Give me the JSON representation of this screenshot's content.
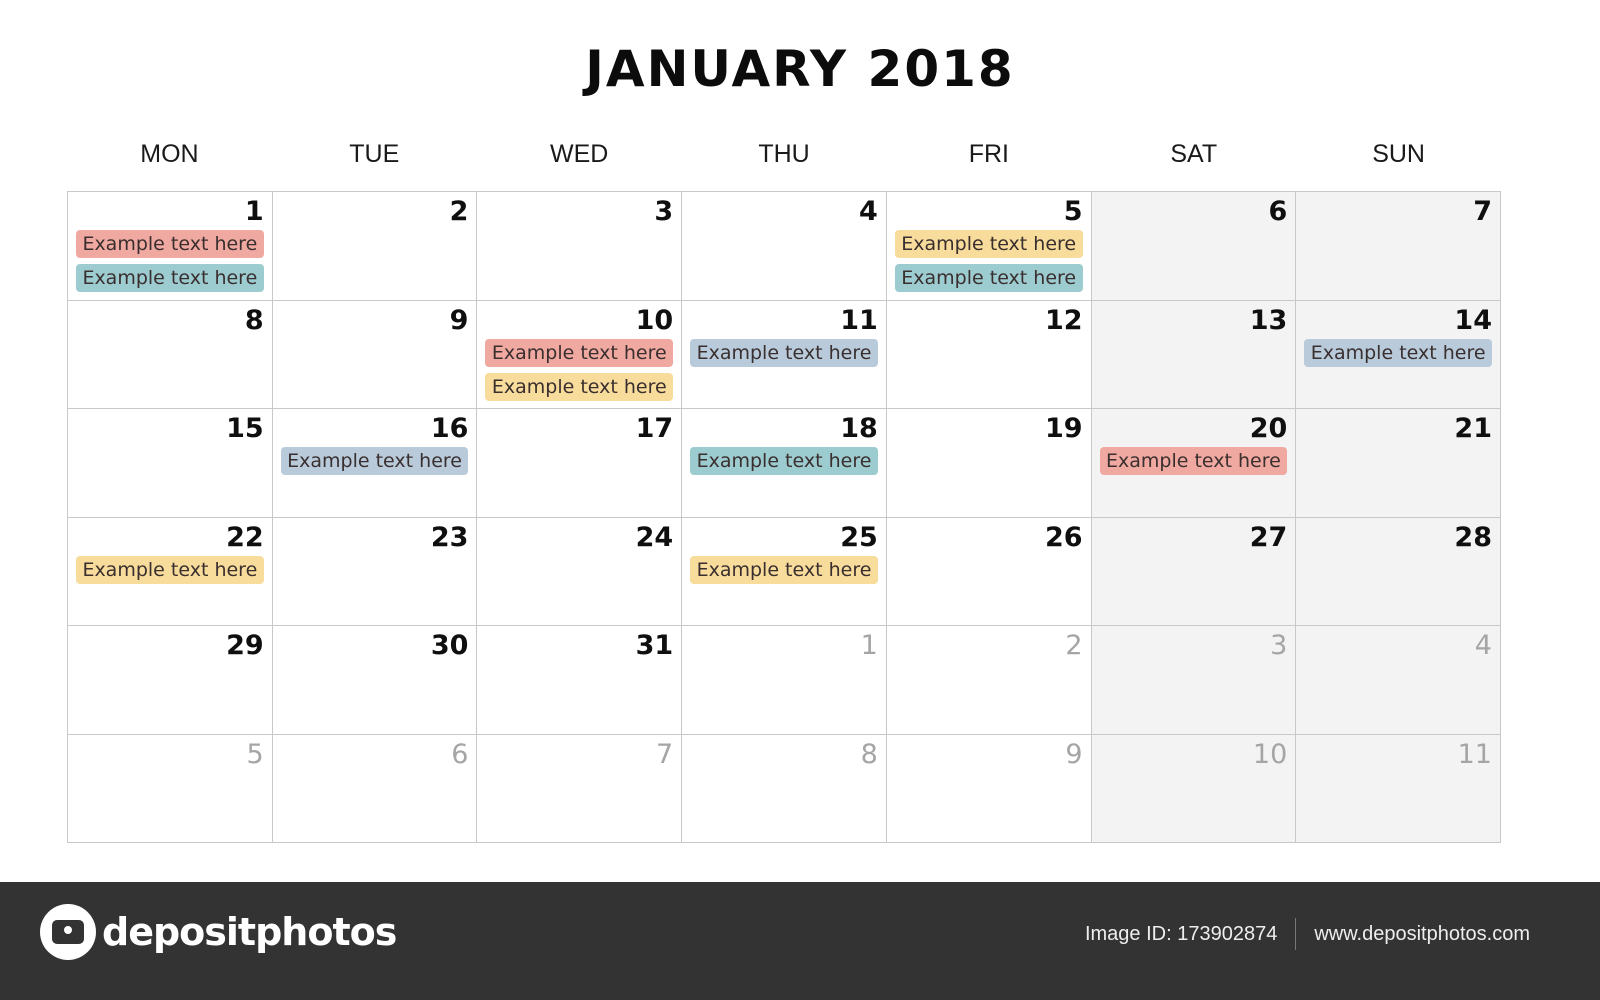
{
  "calendar": {
    "title": "JANUARY 2018",
    "weekdays": [
      "MON",
      "TUE",
      "WED",
      "THU",
      "FRI",
      "SAT",
      "SUN"
    ],
    "event_colors": {
      "red": "#f0a9a0",
      "teal": "#9ccbd0",
      "yellow": "#f8dc9c",
      "blue": "#b9cbdb"
    },
    "weeks": [
      [
        {
          "day": "1",
          "current": true,
          "events": [
            {
              "text": "Example text here",
              "color": "red"
            },
            {
              "text": "Example text here",
              "color": "teal"
            }
          ]
        },
        {
          "day": "2",
          "current": true,
          "events": []
        },
        {
          "day": "3",
          "current": true,
          "events": []
        },
        {
          "day": "4",
          "current": true,
          "events": []
        },
        {
          "day": "5",
          "current": true,
          "events": [
            {
              "text": "Example text here",
              "color": "yellow"
            },
            {
              "text": "Example text here",
              "color": "teal"
            }
          ]
        },
        {
          "day": "6",
          "current": true,
          "events": []
        },
        {
          "day": "7",
          "current": true,
          "events": []
        }
      ],
      [
        {
          "day": "8",
          "current": true,
          "events": []
        },
        {
          "day": "9",
          "current": true,
          "events": []
        },
        {
          "day": "10",
          "current": true,
          "events": [
            {
              "text": "Example text here",
              "color": "red"
            },
            {
              "text": "Example text here",
              "color": "yellow"
            }
          ]
        },
        {
          "day": "11",
          "current": true,
          "events": [
            {
              "text": "Example text here",
              "color": "blue"
            }
          ]
        },
        {
          "day": "12",
          "current": true,
          "events": []
        },
        {
          "day": "13",
          "current": true,
          "events": []
        },
        {
          "day": "14",
          "current": true,
          "events": [
            {
              "text": "Example text here",
              "color": "blue"
            }
          ]
        }
      ],
      [
        {
          "day": "15",
          "current": true,
          "events": []
        },
        {
          "day": "16",
          "current": true,
          "events": [
            {
              "text": "Example text here",
              "color": "blue"
            }
          ]
        },
        {
          "day": "17",
          "current": true,
          "events": []
        },
        {
          "day": "18",
          "current": true,
          "events": [
            {
              "text": "Example text here",
              "color": "teal"
            }
          ]
        },
        {
          "day": "19",
          "current": true,
          "events": []
        },
        {
          "day": "20",
          "current": true,
          "events": [
            {
              "text": "Example text here",
              "color": "red"
            }
          ]
        },
        {
          "day": "21",
          "current": true,
          "events": []
        }
      ],
      [
        {
          "day": "22",
          "current": true,
          "events": [
            {
              "text": "Example text here",
              "color": "yellow"
            }
          ]
        },
        {
          "day": "23",
          "current": true,
          "events": []
        },
        {
          "day": "24",
          "current": true,
          "events": []
        },
        {
          "day": "25",
          "current": true,
          "events": [
            {
              "text": "Example text here",
              "color": "yellow"
            }
          ]
        },
        {
          "day": "26",
          "current": true,
          "events": []
        },
        {
          "day": "27",
          "current": true,
          "events": []
        },
        {
          "day": "28",
          "current": true,
          "events": []
        }
      ],
      [
        {
          "day": "29",
          "current": true,
          "events": []
        },
        {
          "day": "30",
          "current": true,
          "events": []
        },
        {
          "day": "31",
          "current": true,
          "events": []
        },
        {
          "day": "1",
          "current": false,
          "events": []
        },
        {
          "day": "2",
          "current": false,
          "events": []
        },
        {
          "day": "3",
          "current": false,
          "events": []
        },
        {
          "day": "4",
          "current": false,
          "events": []
        }
      ],
      [
        {
          "day": "5",
          "current": false,
          "events": []
        },
        {
          "day": "6",
          "current": false,
          "events": []
        },
        {
          "day": "7",
          "current": false,
          "events": []
        },
        {
          "day": "8",
          "current": false,
          "events": []
        },
        {
          "day": "9",
          "current": false,
          "events": []
        },
        {
          "day": "10",
          "current": false,
          "events": []
        },
        {
          "day": "11",
          "current": false,
          "events": []
        }
      ]
    ]
  },
  "footer": {
    "logo_text": "depositphotos",
    "image_id": "Image ID: 173902874",
    "website": "www.depositphotos.com"
  }
}
